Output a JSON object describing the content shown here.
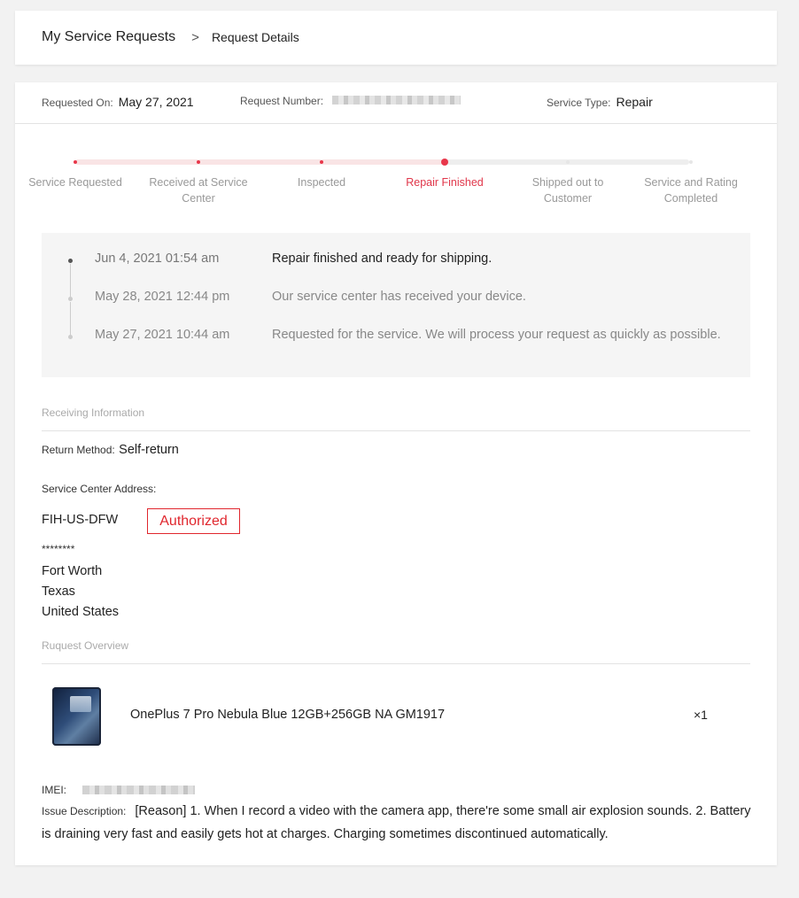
{
  "breadcrumb": {
    "parent": "My Service Requests",
    "separator": ">",
    "current": "Request Details"
  },
  "meta": {
    "requested_on_label": "Requested On:",
    "requested_on": "May 27, 2021",
    "request_number_label": "Request Number:",
    "service_type_label": "Service Type:",
    "service_type": "Repair"
  },
  "progress": {
    "steps": [
      {
        "label": "Service Requested",
        "state": "done"
      },
      {
        "label": "Received at Service Center",
        "state": "done"
      },
      {
        "label": "Inspected",
        "state": "done"
      },
      {
        "label": "Repair Finished",
        "state": "current"
      },
      {
        "label": "Shipped out to Customer",
        "state": "pending"
      },
      {
        "label": "Service and Rating Completed",
        "state": "pending"
      }
    ],
    "accent_color": "#e8364a"
  },
  "timeline": [
    {
      "time": "Jun 4, 2021 01:54 am",
      "message": "Repair finished and ready for shipping."
    },
    {
      "time": "May 28, 2021 12:44 pm",
      "message": "Our service center has received your device."
    },
    {
      "time": "May 27, 2021 10:44 am",
      "message": "Requested for the service. We will process your request as quickly as possible."
    }
  ],
  "receiving": {
    "section_title": "Receiving Information",
    "return_method_label": "Return Method:",
    "return_method": "Self-return",
    "address_label": "Service Center Address:",
    "center_name": "FIH-US-DFW",
    "authorized_badge": "Authorized",
    "address_masked": "********",
    "city": "Fort Worth",
    "state": "Texas",
    "country": "United States"
  },
  "overview": {
    "section_title": "Ruquest Overview",
    "product_name": "OnePlus 7 Pro Nebula Blue 12GB+256GB NA GM1917",
    "quantity": "×1",
    "imei_label": "IMEI:",
    "issue_label": "Issue Description:",
    "issue_text": "[Reason] 1. When I record a video with the camera app, there're some small air explosion sounds. 2. Battery is draining very fast and easily gets hot at charges. Charging sometimes discontinued automatically."
  }
}
